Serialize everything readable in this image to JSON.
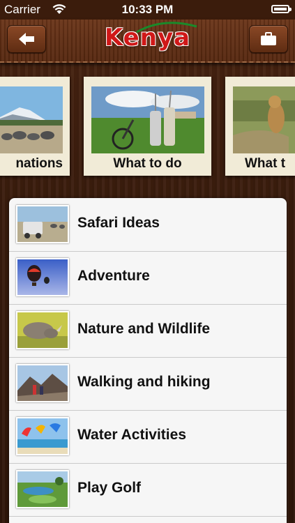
{
  "status_bar": {
    "carrier": "Carrier",
    "time": "10:33 PM"
  },
  "nav": {
    "logo_text": "Kenya",
    "back_icon": "back-arrow-icon",
    "briefcase_icon": "briefcase-icon"
  },
  "carousel": {
    "cards": [
      {
        "label": "nations",
        "image": "mountain-elephants-photo"
      },
      {
        "label": "What to do",
        "image": "bikes-golf-bags-photo"
      },
      {
        "label": "What t",
        "image": "lioness-photo"
      }
    ]
  },
  "list": {
    "items": [
      {
        "label": "Safari Ideas",
        "thumb": "safari-vehicle-photo"
      },
      {
        "label": "Adventure",
        "thumb": "hot-air-balloon-photo"
      },
      {
        "label": "Nature and Wildlife",
        "thumb": "rhino-photo"
      },
      {
        "label": "Walking and hiking",
        "thumb": "hikers-photo"
      },
      {
        "label": "Water Activities",
        "thumb": "kitesurf-photo"
      },
      {
        "label": "Play Golf",
        "thumb": "golf-course-photo"
      }
    ]
  }
}
